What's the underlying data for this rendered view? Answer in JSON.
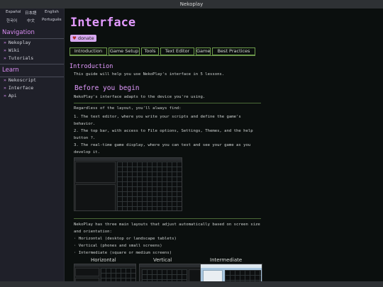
{
  "app": {
    "title": "Nekoplay"
  },
  "sidebar": {
    "languages": [
      "Español",
      "日本語",
      "English",
      "한국어",
      "中文",
      "Português"
    ],
    "navigation_heading": "Navigation",
    "navigation_items": [
      "Nekoplay",
      "Wiki",
      "Tutorials"
    ],
    "learn_heading": "Learn",
    "learn_items": [
      "Nekoscript",
      "Interface",
      "Api"
    ],
    "bullet": "»"
  },
  "page": {
    "title": "Interface",
    "donate_label": "donate",
    "tabs": [
      "Introduction",
      "Game Setup",
      "Tools",
      "Text Editor",
      "Game",
      "Best Practices"
    ],
    "active_tab": "Introduction",
    "section_heading": "Introduction",
    "intro": "This guide will help you use NekoPlay's interface in 5 lessons.",
    "subheading": "Before you begin",
    "adapts": "NekoPlay's interface adapts to the device you're using.",
    "regardless": "Regardless of the layout, you'll always find:",
    "item1": "1. The text editor, where you write your scripts and define the game's behavior.",
    "item2": "2. The top bar, with access to File options, Settings, Themes, and the help button ?.",
    "item3": "3. The real-time game display, where you can test and see your game as you develop it.",
    "layouts_intro": "NekoPlay has three main layouts that adjust automatically based on screen size and orientation:",
    "layouts": [
      "· Horizontal (desktop or landscape tablets)",
      "· Vertical (phones and small screens)",
      "· Intermediate (square or medium screens)"
    ],
    "layout_captions": [
      "Horizontal",
      "Vertical",
      "Intermediate"
    ]
  },
  "colors": {
    "accent": "#e39aff",
    "tab_border": "#6d9a4b",
    "sidebar_bg": "#1f2029",
    "page_bg": "#0b0f0e"
  }
}
